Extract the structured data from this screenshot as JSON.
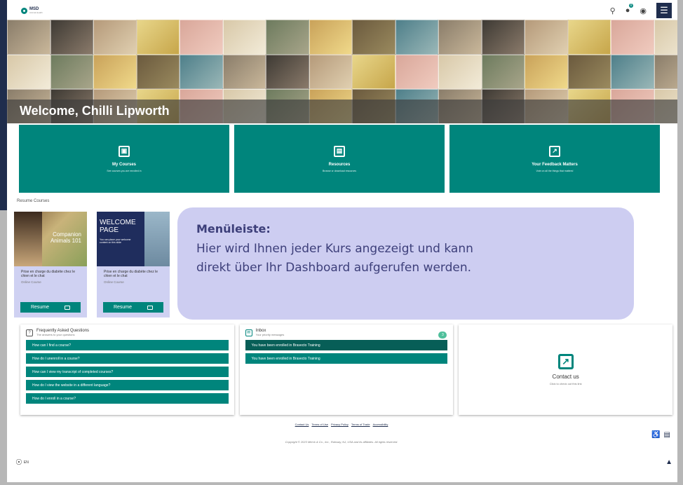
{
  "header": {
    "logo": "MSD",
    "logo_sub": "Animal Health",
    "icons": [
      "search-icon",
      "cart-icon",
      "user-icon",
      "hamburger-menu-icon"
    ],
    "cart_badge": "0"
  },
  "hero": {
    "title": "Welcome, Chilli Lipworth"
  },
  "cards": [
    {
      "title": "My Courses",
      "subtitle": "See courses you are enrolled in",
      "icon": "courses-icon"
    },
    {
      "title": "Resources",
      "subtitle": "Browse or download resources",
      "icon": "book-icon"
    },
    {
      "title": "Your Feedback Matters",
      "subtitle": "Vote on all the things that matters!",
      "icon": "external-link-icon"
    }
  ],
  "resume": {
    "label": "Resume Courses",
    "courses": [
      {
        "image_text": "Companion Animals 101",
        "title": "Prise en charge du diabète chez le chien et le chat",
        "type": "Online Course",
        "button": "Resume"
      },
      {
        "image_text": "WELCOME PAGE",
        "image_sub": "You can place your welcome content on this slide",
        "title": "Prise en charge du diabète chez le chien et le chat",
        "type": "Online Course",
        "button": "Resume"
      }
    ]
  },
  "overlay": {
    "title": "Menüleiste:",
    "line1": "Hier wird Ihnen jeder Kurs angezeigt und kann",
    "line2": "direkt über Ihr Dashboard aufgerufen werden."
  },
  "faq": {
    "title": "Frequently Asked Questions",
    "subtitle": "The answers to your questions",
    "items": [
      "How can I find a course?",
      "How do I unenroll in a course?",
      "How can I view my transcript of completed courses?",
      "How do I view the website in a different language?",
      "How do I enroll in a course?"
    ]
  },
  "inbox": {
    "title": "Inbox",
    "subtitle": "Your priority messages",
    "count": "3",
    "items": [
      "You have been enrolled in Bravecto Training",
      "You have been enrolled in Bravecto Training"
    ]
  },
  "contact": {
    "title": "Contact us",
    "subtitle": "Click to check out this link"
  },
  "footer": {
    "links": [
      "Contact Us",
      "Terms of Use",
      "Privacy Policy",
      "Terms of Trade",
      "Accessibility"
    ],
    "copyright": "Copyright © 2023 Merck & Co., Inc., Rahway, NJ, USA and its affiliates. All rights reserved.",
    "language": "EN"
  }
}
